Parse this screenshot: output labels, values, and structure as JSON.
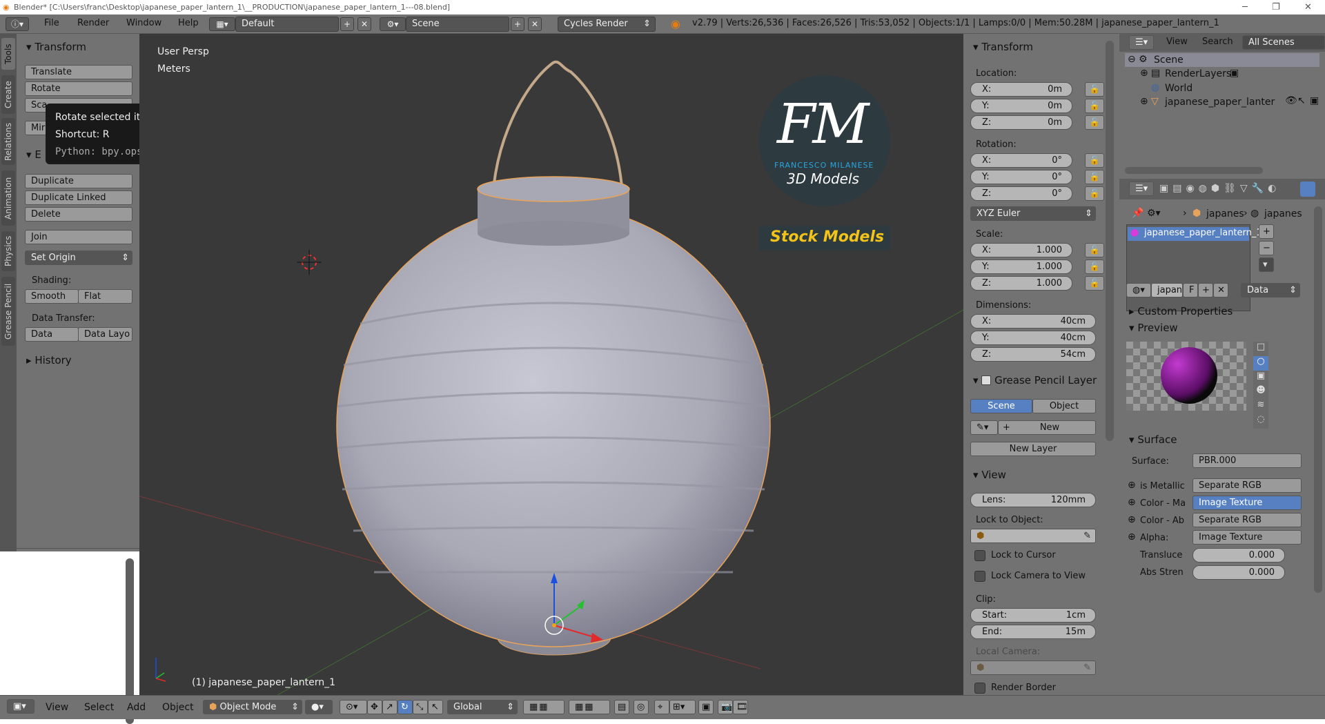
{
  "titlebar": {
    "text": "Blender* [C:\\Users\\franc\\Desktop\\japanese_paper_lantern_1\\__PRODUCTION\\japanese_paper_lantern_1---08.blend]"
  },
  "menu": {
    "file": "File",
    "render": "Render",
    "window": "Window",
    "help": "Help"
  },
  "layout": {
    "screen": "Default",
    "scene": "Scene",
    "engine": "Cycles Render"
  },
  "stats": "v2.79 | Verts:26,536 | Faces:26,526 | Tris:53,052 | Objects:1/1 | Lamps:0/0 | Mem:50.28M | japanese_paper_lantern_1",
  "tabs": [
    "Tools",
    "Create",
    "Relations",
    "Animation",
    "Physics",
    "Grease Pencil"
  ],
  "toolshelf": {
    "transform_title": "Transform",
    "translate": "Translate",
    "rotate": "Rotate",
    "scale": "Sca",
    "mirror": "Mir",
    "edit_title": "E",
    "duplicate": "Duplicate",
    "duplicate_linked": "Duplicate Linked",
    "delete": "Delete",
    "join": "Join",
    "set_origin": "Set Origin",
    "shading_label": "Shading:",
    "smooth": "Smooth",
    "flat": "Flat",
    "data_transfer_label": "Data Transfer:",
    "data": "Data",
    "data_layo": "Data Layo",
    "history": "History"
  },
  "tooltip": {
    "title": "Rotate selected items.",
    "shortcut": "Shortcut: R",
    "python": "Python: bpy.ops.transform.rotate()"
  },
  "viewport": {
    "view_name": "User Persp",
    "units": "Meters",
    "object_label": "(1) japanese_paper_lantern_1",
    "logo_letters": "FM",
    "logo_name": "FRANCESCO MILANESE",
    "logo_sub": "3D Models",
    "stock": "Stock Models"
  },
  "npanel": {
    "transform": "Transform",
    "location": "Location:",
    "rotation": "Rotation:",
    "scale": "Scale:",
    "dimensions": "Dimensions:",
    "loc": [
      {
        "l": "X:",
        "v": "0m"
      },
      {
        "l": "Y:",
        "v": "0m"
      },
      {
        "l": "Z:",
        "v": "0m"
      }
    ],
    "rot": [
      {
        "l": "X:",
        "v": "0°"
      },
      {
        "l": "Y:",
        "v": "0°"
      },
      {
        "l": "Z:",
        "v": "0°"
      }
    ],
    "rotmode": "XYZ Euler",
    "scl": [
      {
        "l": "X:",
        "v": "1.000"
      },
      {
        "l": "Y:",
        "v": "1.000"
      },
      {
        "l": "Z:",
        "v": "1.000"
      }
    ],
    "dim": [
      {
        "l": "X:",
        "v": "40cm"
      },
      {
        "l": "Y:",
        "v": "40cm"
      },
      {
        "l": "Z:",
        "v": "54cm"
      }
    ],
    "gp_title": "Grease Pencil Layer",
    "gp_scene": "Scene",
    "gp_object": "Object",
    "gp_new": "New",
    "gp_new_layer": "New Layer",
    "view_title": "View",
    "lens_label": "Lens:",
    "lens_value": "120mm",
    "lock_obj": "Lock to Object:",
    "lock_cursor": "Lock to Cursor",
    "lock_camera": "Lock Camera to View",
    "clip": "Clip:",
    "clip_start_l": "Start:",
    "clip_start_v": "1cm",
    "clip_end_l": "End:",
    "clip_end_v": "15m",
    "local_camera": "Local Camera:",
    "render_border": "Render Border"
  },
  "outliner": {
    "view": "View",
    "search": "Search",
    "scenes": "All Scenes",
    "items": [
      "Scene",
      "RenderLayers",
      "World",
      "japanese_paper_lanter"
    ]
  },
  "props": {
    "crumb1": "japanes",
    "crumb2": "japanes",
    "material": "japanese_paper_lantern_1",
    "mat_short": "japan",
    "f": "F",
    "data": "Data",
    "custom": "Custom Properties",
    "preview": "Preview",
    "surface_title": "Surface",
    "surface_label": "Surface:",
    "surface_value": "PBR.000",
    "rows": [
      {
        "l": "is Metallic",
        "v": "Separate RGB"
      },
      {
        "l": "Color - Ma",
        "v": "Image Texture"
      },
      {
        "l": "Color - Ab",
        "v": "Separate RGB"
      },
      {
        "l": "Alpha:",
        "v": "Image Texture"
      }
    ],
    "translu_l": "Transluce",
    "translu_v": "0.000",
    "abs_l": "Abs Stren",
    "abs_v": "0.000"
  },
  "bottombar": {
    "view": "View",
    "select": "Select",
    "add": "Add",
    "object": "Object",
    "mode": "Object Mode",
    "orient": "Global"
  }
}
